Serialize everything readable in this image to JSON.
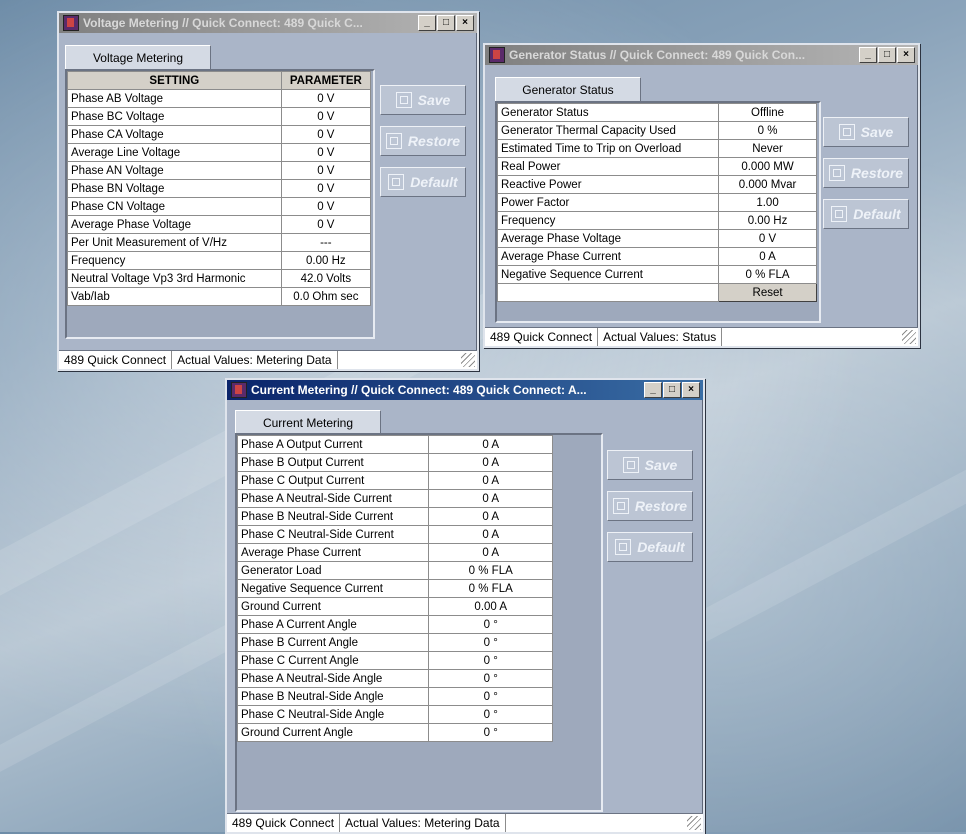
{
  "voltage_window": {
    "title": "Voltage Metering // Quick Connect: 489 Quick C...",
    "tab": "Voltage Metering",
    "headers": [
      "SETTING",
      "PARAMETER"
    ],
    "rows": [
      [
        "Phase AB Voltage",
        "0 V"
      ],
      [
        "Phase BC Voltage",
        "0 V"
      ],
      [
        "Phase CA Voltage",
        "0 V"
      ],
      [
        "Average Line Voltage",
        "0 V"
      ],
      [
        "Phase AN Voltage",
        "0 V"
      ],
      [
        "Phase BN Voltage",
        "0 V"
      ],
      [
        "Phase CN Voltage",
        "0 V"
      ],
      [
        "Average Phase Voltage",
        "0 V"
      ],
      [
        "Per Unit Measurement of V/Hz",
        "---"
      ],
      [
        "Frequency",
        "0.00 Hz"
      ],
      [
        "Neutral Voltage Vp3 3rd Harmonic",
        "42.0 Volts"
      ],
      [
        "Vab/Iab",
        "0.0 Ohm sec"
      ]
    ],
    "buttons": {
      "save": "Save",
      "restore": "Restore",
      "default": "Default"
    },
    "status": {
      "device": "489 Quick Connect",
      "section": "Actual Values: Metering Data"
    }
  },
  "generator_window": {
    "title": "Generator Status // Quick Connect: 489 Quick Con...",
    "tab": "Generator Status",
    "rows": [
      [
        "Generator Status",
        "Offline"
      ],
      [
        "Generator Thermal Capacity Used",
        "0 %"
      ],
      [
        "Estimated Time to Trip on Overload",
        "Never"
      ],
      [
        "Real Power",
        "0.000 MW"
      ],
      [
        "Reactive Power",
        "0.000 Mvar"
      ],
      [
        "Power Factor",
        "1.00"
      ],
      [
        "Frequency",
        "0.00 Hz"
      ],
      [
        "Average Phase Voltage",
        "0 V"
      ],
      [
        "Average Phase Current",
        "0 A"
      ],
      [
        "Negative Sequence Current",
        "0 % FLA"
      ]
    ],
    "reset_label": "Reset",
    "buttons": {
      "save": "Save",
      "restore": "Restore",
      "default": "Default"
    },
    "status": {
      "device": "489 Quick Connect",
      "section": "Actual Values: Status"
    }
  },
  "current_window": {
    "title": "Current Metering // Quick Connect: 489 Quick Connect: A...",
    "tab": "Current Metering",
    "rows": [
      [
        "Phase A Output Current",
        "0 A"
      ],
      [
        "Phase B Output Current",
        "0 A"
      ],
      [
        "Phase C Output Current",
        "0 A"
      ],
      [
        "Phase A Neutral-Side Current",
        "0 A"
      ],
      [
        "Phase B Neutral-Side Current",
        "0 A"
      ],
      [
        "Phase C Neutral-Side Current",
        "0 A"
      ],
      [
        "Average Phase Current",
        "0 A"
      ],
      [
        "Generator Load",
        "0 % FLA"
      ],
      [
        "Negative Sequence Current",
        "0 % FLA"
      ],
      [
        "Ground Current",
        "0.00 A"
      ],
      [
        "Phase A Current Angle",
        "0 °"
      ],
      [
        "Phase B Current Angle",
        "0 °"
      ],
      [
        "Phase C Current Angle",
        "0 °"
      ],
      [
        "Phase A  Neutral-Side Angle",
        "0 °"
      ],
      [
        "Phase B  Neutral-Side Angle",
        "0 °"
      ],
      [
        "Phase C  Neutral-Side Angle",
        "0 °"
      ],
      [
        "Ground Current Angle",
        "0 °"
      ]
    ],
    "buttons": {
      "save": "Save",
      "restore": "Restore",
      "default": "Default"
    },
    "status": {
      "device": "489 Quick Connect",
      "section": "Actual Values: Metering Data"
    }
  }
}
